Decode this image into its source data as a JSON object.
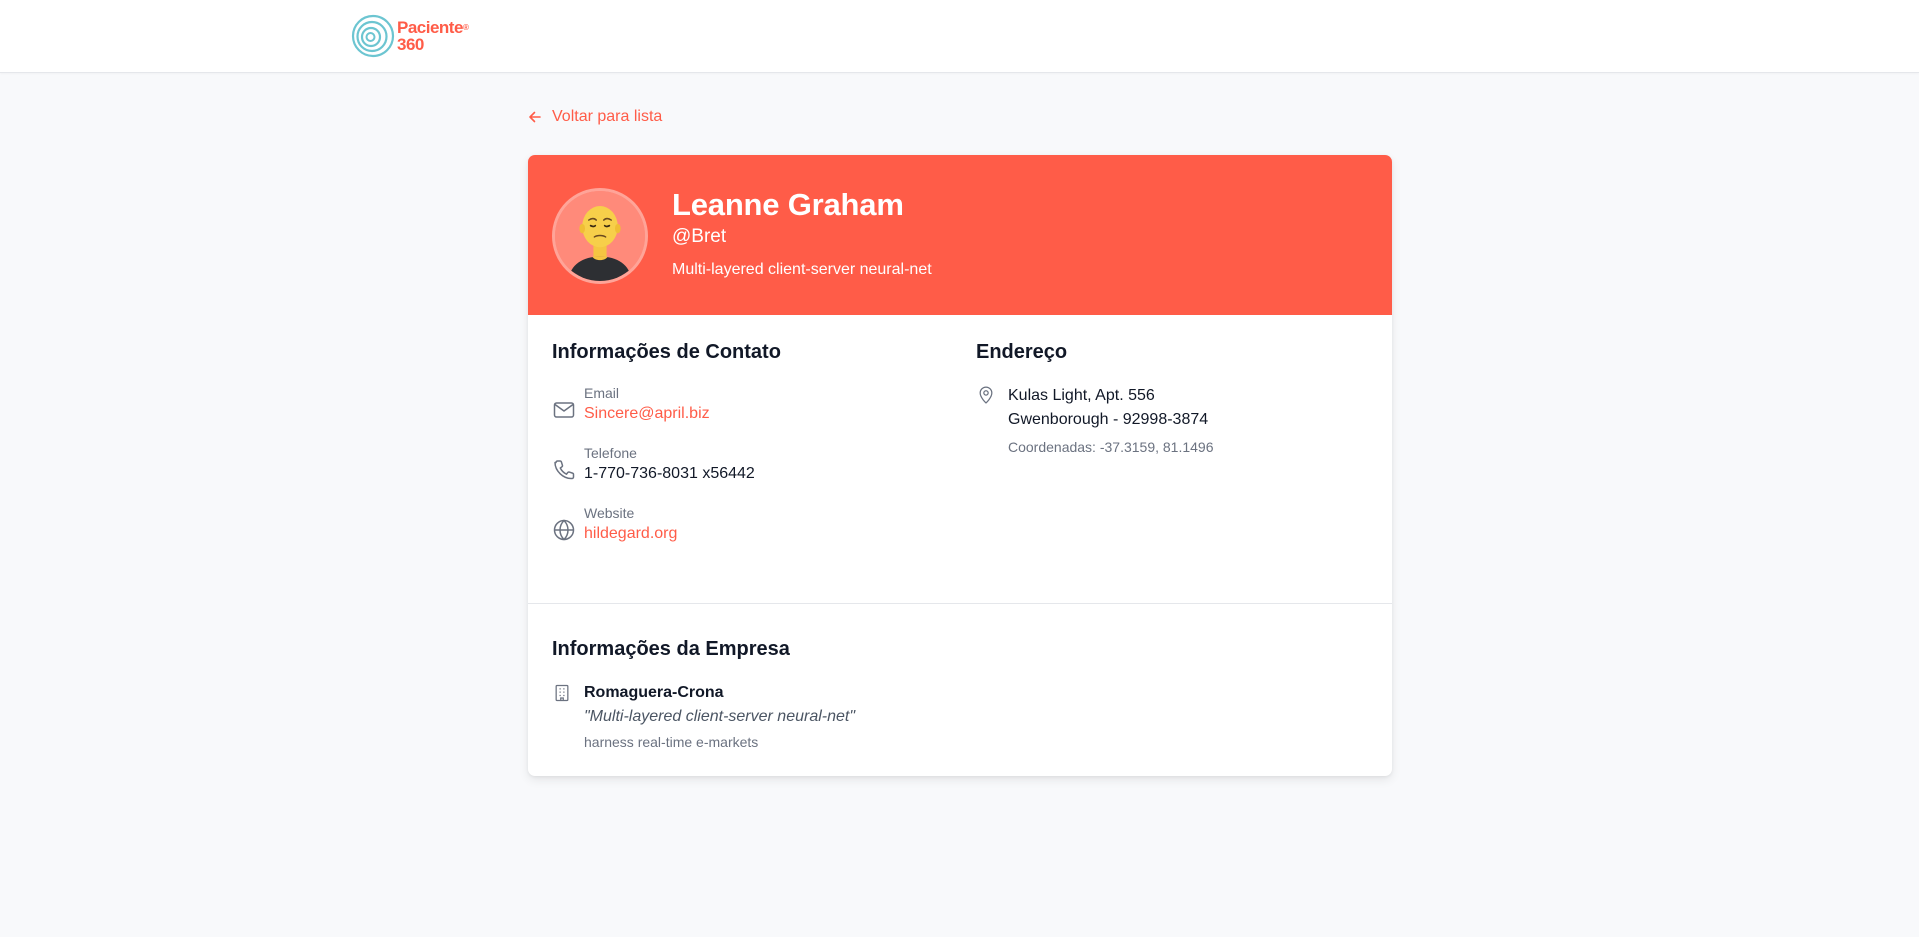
{
  "header": {
    "logo_line1": "Paciente",
    "logo_line2": "360",
    "logo_mark": "®"
  },
  "nav": {
    "back_label": "Voltar para lista",
    "back_icon": "arrow-left-icon"
  },
  "profile": {
    "name": "Leanne Graham",
    "username": "@Bret",
    "catch_phrase": "Multi-layered client-server neural-net",
    "avatar_icon": "person-avatar"
  },
  "contact": {
    "title": "Informações de Contato",
    "email_label": "Email",
    "email": "Sincere@april.biz",
    "phone_label": "Telefone",
    "phone": "1-770-736-8031 x56442",
    "website_label": "Website",
    "website": "hildegard.org"
  },
  "address": {
    "title": "Endereço",
    "street_line": "Kulas Light, Apt. 556",
    "city_line": "Gwenborough - 92998-3874",
    "coordinates": "Coordenadas: -37.3159, 81.1496"
  },
  "company": {
    "title": "Informações da Empresa",
    "name": "Romaguera-Crona",
    "catch_phrase": "\"Multi-layered client-server neural-net\"",
    "bs": "harness real-time e-markets"
  },
  "colors": {
    "accent": "#ff5c48",
    "background": "#f8f9fb",
    "text": "#111827",
    "muted": "#6b7280"
  }
}
